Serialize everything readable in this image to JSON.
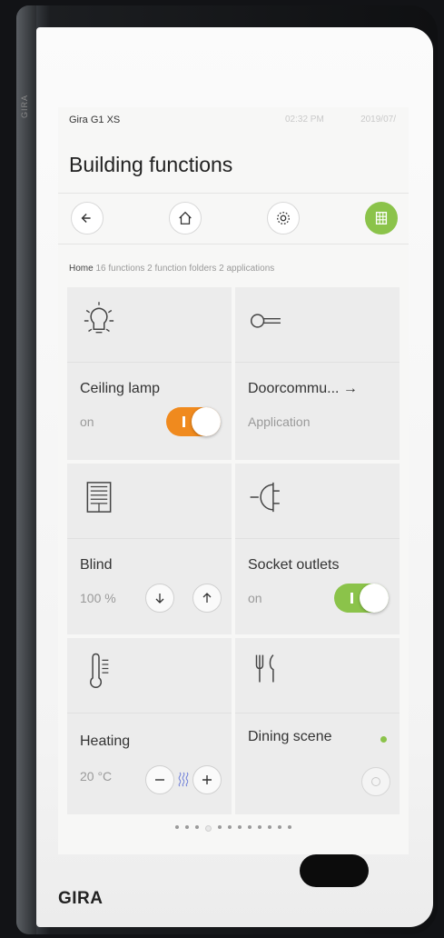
{
  "device": {
    "brand_footer": "GIRA",
    "side_brand": "GIRA"
  },
  "status_bar": {
    "device_name": "Gira G1 XS",
    "time": "02:32 PM",
    "date": "2019/07/"
  },
  "page_title": "Building functions",
  "nav": [
    {
      "name": "back",
      "icon": "arrow-left-icon",
      "active": false
    },
    {
      "name": "home",
      "icon": "home-icon",
      "active": false
    },
    {
      "name": "settings",
      "icon": "gear-icon",
      "active": false
    },
    {
      "name": "overview",
      "icon": "grid-icon",
      "active": true
    }
  ],
  "breadcrumb": {
    "home": "Home",
    "summary": "16 functions 2 function folders 2 applications"
  },
  "tiles": [
    {
      "name": "Ceiling lamp",
      "status": "on",
      "icon": "lightbulb-icon",
      "control": "toggle",
      "state": "on",
      "color": "#f08a1e"
    },
    {
      "name": "Doorcommu... →",
      "status": "Application",
      "icon": "key-icon",
      "control": "link"
    },
    {
      "name": "Blind",
      "status": "100 %",
      "icon": "blind-icon",
      "control": "up-down"
    },
    {
      "name": "Socket outlets",
      "status": "on",
      "icon": "plug-icon",
      "control": "toggle",
      "state": "on",
      "color": "#8bc34a"
    },
    {
      "name": "Heating",
      "status": "20 °C",
      "icon": "thermometer-icon",
      "control": "plus-minus"
    },
    {
      "name": "Dining scene",
      "status": "",
      "icon": "cutlery-icon",
      "control": "scene"
    }
  ],
  "pager": {
    "count": 12,
    "active_index": 3
  },
  "colors": {
    "accent_green": "#8bc34a",
    "accent_orange": "#f08a1e"
  }
}
